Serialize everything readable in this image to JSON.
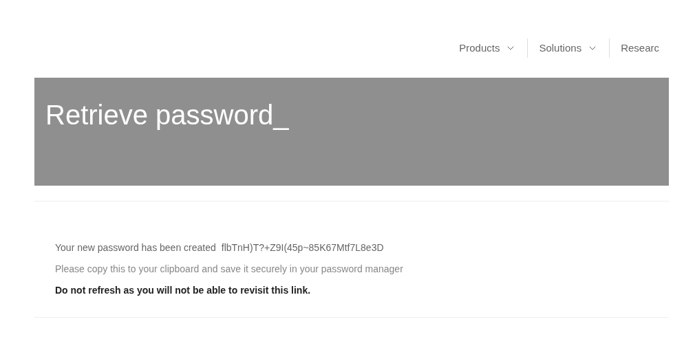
{
  "nav": [
    {
      "label": "Products",
      "dropdown": true
    },
    {
      "label": "Solutions",
      "dropdown": true
    },
    {
      "label": "Researc",
      "dropdown": false
    }
  ],
  "banner": {
    "title": "Retrieve password_"
  },
  "message": {
    "created_label": "Your new password has been created",
    "password": "flbTnH)T?+Z9I(45p~85K67Mtf7L8e3D",
    "instruction": "Please copy this to your clipboard and save it securely in your password manager",
    "warning": "Do not refresh as you will not be able to revisit this link."
  }
}
